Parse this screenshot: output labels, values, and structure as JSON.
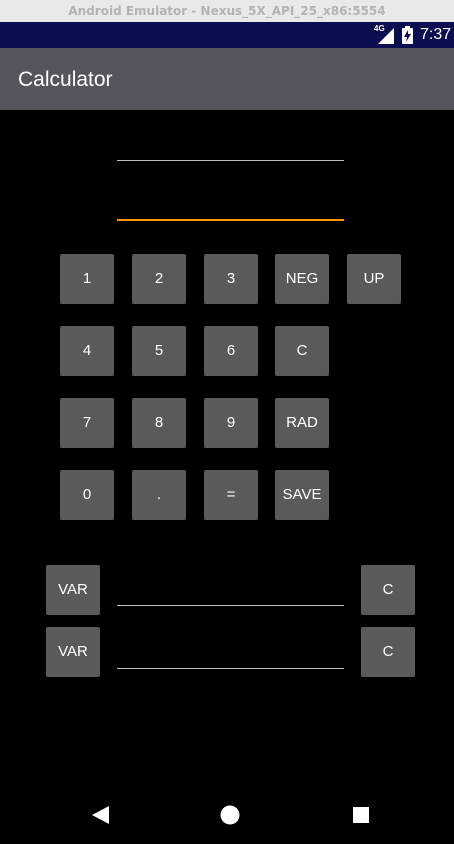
{
  "window": {
    "title": "Android Emulator - Nexus_5X_API_25_x86:5554"
  },
  "status_bar": {
    "network": "4G",
    "time": "7:37"
  },
  "app_bar": {
    "title": "Calculator"
  },
  "display": {
    "expression_value": "",
    "result_value": ""
  },
  "keypad": {
    "row1": [
      "1",
      "2",
      "3",
      "NEG",
      "UP"
    ],
    "row2": [
      "4",
      "5",
      "6",
      "C"
    ],
    "row3": [
      "7",
      "8",
      "9",
      "RAD"
    ],
    "row4": [
      "0",
      ".",
      "=",
      "SAVE"
    ]
  },
  "variables": [
    {
      "var_label": "VAR",
      "value": "",
      "clear_label": "C"
    },
    {
      "var_label": "VAR",
      "value": "",
      "clear_label": "C"
    }
  ],
  "colors": {
    "status_bar": "#0b0f4f",
    "action_bar": "#53565c",
    "button": "#5a5a5a",
    "focus_accent": "#ff9800",
    "background": "#000000"
  },
  "icons": {
    "nav_back": "back-triangle-icon",
    "nav_home": "home-circle-icon",
    "nav_recents": "recents-square-icon",
    "signal": "cell-signal-icon",
    "battery": "battery-charging-icon"
  }
}
